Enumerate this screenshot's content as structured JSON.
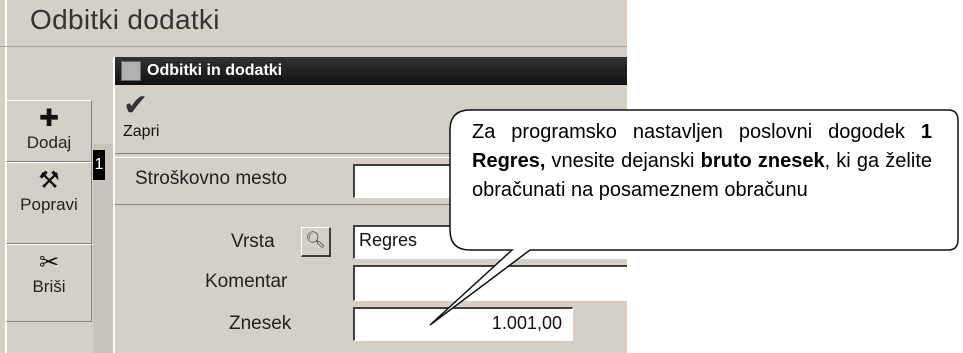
{
  "window": {
    "title": "Odbitki dodatki"
  },
  "toolbar": {
    "add_label": "Dodaj",
    "edit_label": "Popravi",
    "delete_label": "Briši"
  },
  "grid": {
    "row_number": "1"
  },
  "dialog": {
    "title": "Odbitki in dodatki",
    "close_label": "Zapri",
    "cost_center_label": "Stroškovno mesto",
    "cost_center_value": "",
    "type_label": "Vrsta",
    "type_value": "Regres",
    "comment_label": "Komentar",
    "comment_value": "",
    "amount_label": "Znesek",
    "amount_value": "1.001,00"
  },
  "callout": {
    "t1": "Za programsko nastavljen poslovni dogodek ",
    "b1": "1 Regres,",
    "t2": " vnesite dejanski ",
    "b2": "bruto znesek",
    "t3": ", ki ga želite obračunati na posameznem obračunu"
  },
  "icons": {
    "add": "plus-icon",
    "edit": "hammer-icon",
    "delete": "scissors-icon",
    "close": "checkmark-icon",
    "search": "magnifier-icon"
  }
}
